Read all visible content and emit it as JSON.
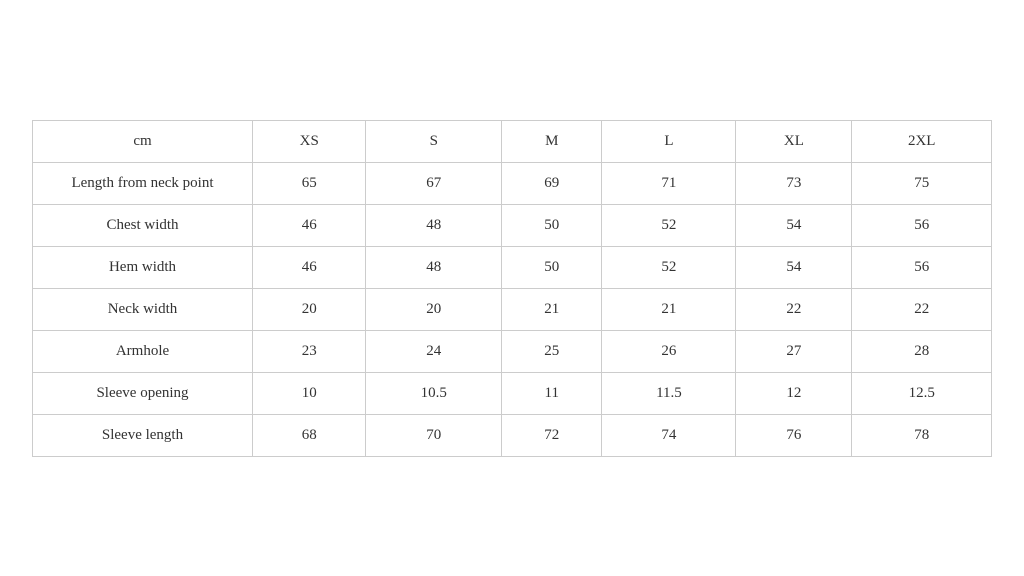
{
  "table": {
    "unit_label": "cm",
    "columns": [
      "XS",
      "S",
      "M",
      "L",
      "XL",
      "2XL"
    ],
    "rows": [
      {
        "label": "Length from neck point",
        "values": [
          "65",
          "67",
          "69",
          "71",
          "73",
          "75"
        ]
      },
      {
        "label": "Chest width",
        "values": [
          "46",
          "48",
          "50",
          "52",
          "54",
          "56"
        ]
      },
      {
        "label": "Hem width",
        "values": [
          "46",
          "48",
          "50",
          "52",
          "54",
          "56"
        ]
      },
      {
        "label": "Neck width",
        "values": [
          "20",
          "20",
          "21",
          "21",
          "22",
          "22"
        ]
      },
      {
        "label": "Armhole",
        "values": [
          "23",
          "24",
          "25",
          "26",
          "27",
          "28"
        ]
      },
      {
        "label": "Sleeve opening",
        "values": [
          "10",
          "10.5",
          "11",
          "11.5",
          "12",
          "12.5"
        ]
      },
      {
        "label": "Sleeve length",
        "values": [
          "68",
          "70",
          "72",
          "74",
          "76",
          "78"
        ]
      }
    ]
  }
}
